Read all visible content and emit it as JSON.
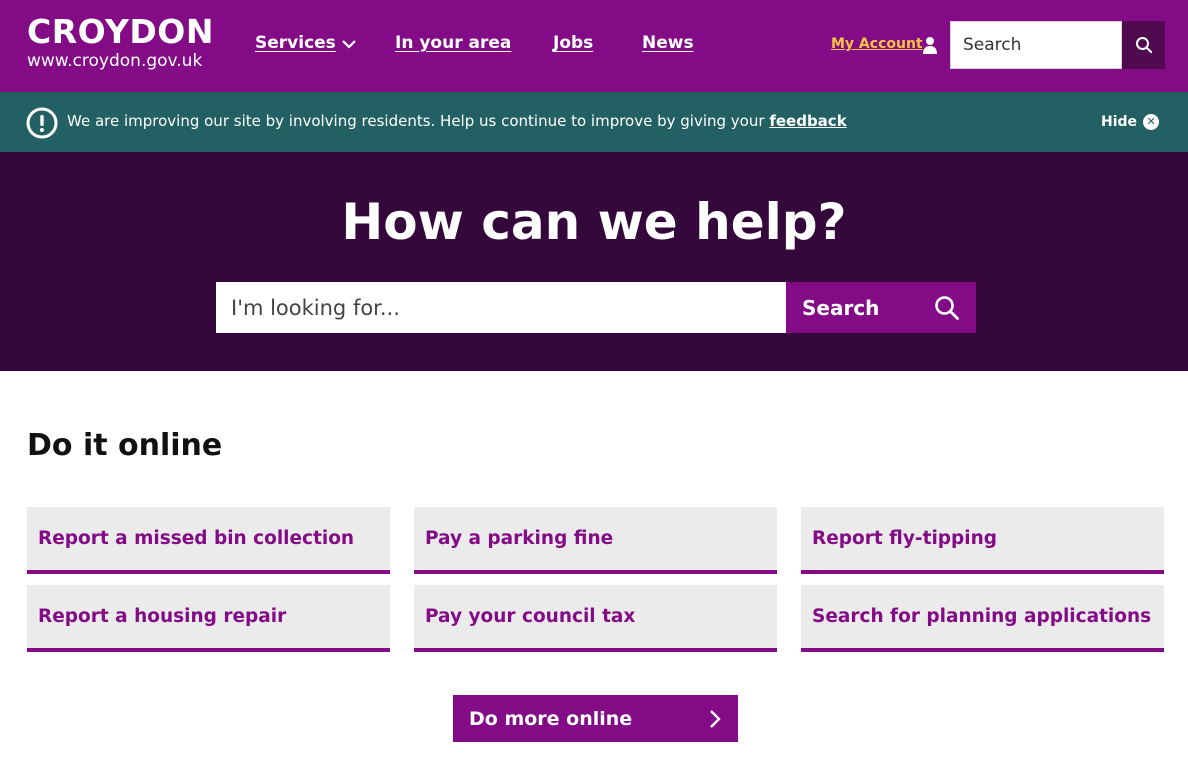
{
  "header": {
    "logo_name": "CROYDON",
    "logo_url": "www.croydon.gov.uk",
    "nav": [
      {
        "label": "Services"
      },
      {
        "label": "In your area"
      },
      {
        "label": "Jobs"
      },
      {
        "label": "News"
      }
    ],
    "account_label": "My Account",
    "search_placeholder": "Search",
    "brand_color": "#830c86",
    "account_color": "#f7c544"
  },
  "banner": {
    "message": "We are improving our site by involving residents. Help us continue to improve by giving your",
    "link_label": "feedback",
    "hide_label": "Hide",
    "color": "#226063"
  },
  "hero": {
    "title": "How can we help?",
    "search_placeholder": "I'm looking for...",
    "search_button": "Search",
    "background": "#34083a"
  },
  "main": {
    "section_title": "Do it online",
    "tiles": [
      {
        "label": "Report a missed bin collection"
      },
      {
        "label": "Pay a parking fine"
      },
      {
        "label": "Report fly-tipping"
      },
      {
        "label": "Report a housing repair"
      },
      {
        "label": "Pay your council tax"
      },
      {
        "label": "Search for planning applications"
      }
    ],
    "more_button": "Do more online"
  },
  "icons": {
    "nav_chevron": "chevron-down-icon",
    "account": "user-icon",
    "search": "search-icon",
    "banner": "exclamation-circle-icon",
    "hide": "close-icon",
    "more": "chevron-right-icon"
  }
}
